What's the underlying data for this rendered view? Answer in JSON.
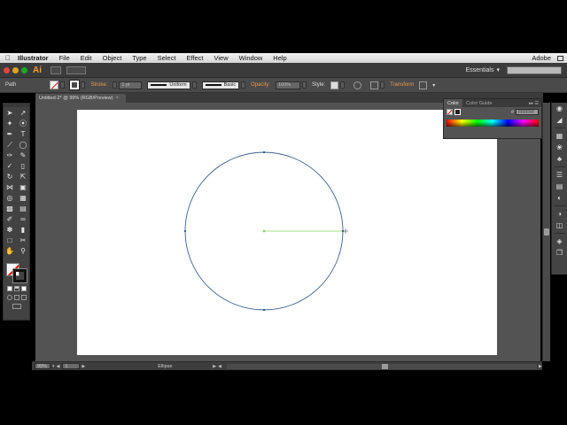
{
  "menubar": {
    "app_name": "Illustrator",
    "items": [
      "File",
      "Edit",
      "Object",
      "Type",
      "Select",
      "Effect",
      "View",
      "Window",
      "Help"
    ],
    "right_label": "Adobe"
  },
  "appbar": {
    "logo": "Ai",
    "workspace": "Essentials"
  },
  "control": {
    "selection_label": "Path",
    "stroke_label": "Stroke:",
    "stroke_weight": "1 pt",
    "profile": "Uniform",
    "brush": "Basic",
    "opacity_label": "Opacity:",
    "opacity_value": "100%",
    "style_label": "Style:",
    "transform_label": "Transform"
  },
  "document": {
    "tab_title": "Untitled-2* @ 99% (RGB/Preview)"
  },
  "status": {
    "zoom": "99%",
    "page": "1",
    "tool": "Ellipse"
  },
  "color_panel": {
    "tabs": [
      "Color",
      "Color Guide"
    ],
    "hash": "#",
    "hex": "FFFFFF"
  },
  "colors": {
    "ellipse_stroke": "#3a5f8a",
    "guide_line": "#8fd45b",
    "accent_orange": "#e89a4e"
  },
  "icons": {
    "tools": [
      "selection-tool-icon",
      "direct-selection-tool-icon",
      "magic-wand-tool-icon",
      "lasso-tool-icon",
      "pen-tool-icon",
      "type-tool-icon",
      "line-segment-tool-icon",
      "ellipse-tool-icon",
      "paintbrush-tool-icon",
      "pencil-tool-icon",
      "blob-brush-tool-icon",
      "eraser-tool-icon",
      "rotate-tool-icon",
      "scale-tool-icon",
      "width-tool-icon",
      "free-transform-tool-icon",
      "shape-builder-tool-icon",
      "perspective-grid-tool-icon",
      "mesh-tool-icon",
      "gradient-tool-icon",
      "eyedropper-tool-icon",
      "blend-tool-icon",
      "symbol-sprayer-tool-icon",
      "column-graph-tool-icon",
      "artboard-tool-icon",
      "slice-tool-icon",
      "hand-tool-icon",
      "zoom-tool-icon"
    ]
  }
}
